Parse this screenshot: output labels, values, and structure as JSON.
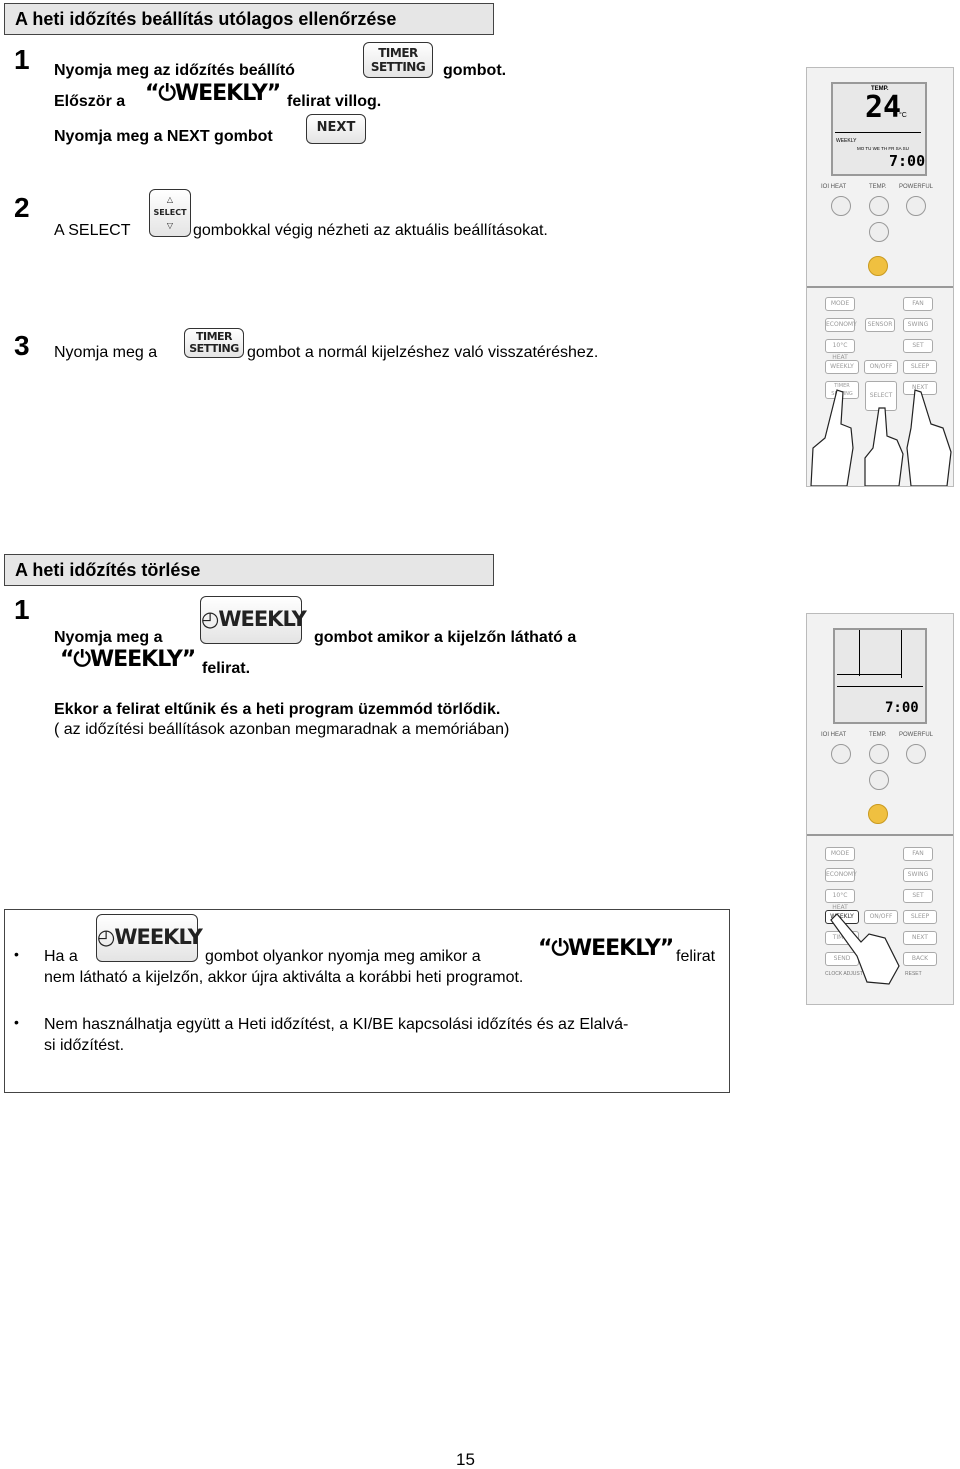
{
  "section1": {
    "title": "A heti időzítés beállítás utólagos ellenőrzése",
    "step1": {
      "number": "1",
      "line1a": "Nyomja meg az időzítés beállító",
      "line1b": "gombot.",
      "line2a": "Először a",
      "line2b": "felirat villog.",
      "line3": "Nyomja meg a NEXT gombot"
    },
    "step2": {
      "number": "2",
      "before": "A SELECT",
      "after": "gombokkal végig nézheti az aktuális beállításokat."
    },
    "step3": {
      "number": "3",
      "before": "Nyomja meg a",
      "after": "gombot a normál kijelzéshez való visszatéréshez."
    }
  },
  "section2": {
    "title": "A heti időzítés törlése",
    "step1": {
      "number": "1",
      "line1a": "Nyomja meg a",
      "line1b": "gombot amikor a kijelzőn látható a",
      "line2": "felirat.",
      "line3": "Ekkor a felirat eltűnik és a heti program üzemmód törlődik.",
      "line4": "( az időzítési beállítások azonban megmaradnak a memóriában)"
    }
  },
  "notes": [
    {
      "before": "Ha a",
      "middle": "gombot olyankor nyomja meg amikor a",
      "after": "felirat",
      "line2": "nem látható a kijelzőn, akkor újra aktiválta a korábbi heti programot."
    },
    {
      "line1": "Nem használhatja együtt  a  Heti időzítést,  a KI/BE kapcsolási időzítés és az Elalvá-",
      "line2": "si időzítést."
    }
  ],
  "buttons": {
    "timer_line1": "TIMER",
    "timer_line2": "SETTING",
    "next": "NEXT",
    "select": "SELECT",
    "weekly": "WEEKLY",
    "weekly_quoted": "“⏻WEEKLY”"
  },
  "remote1": {
    "temp_label": "TEMP.",
    "temp": "24",
    "unit": "°C",
    "weekly": "WEEKLY",
    "days": "MO TU WE TH FR SA SU",
    "time": "7:00",
    "labels": [
      "IOI HEAT",
      "TEMP.",
      "POWERFUL"
    ],
    "keys": [
      "MODE",
      "FAN",
      "ECONOMY",
      "SENSOR",
      "SWING",
      "10°C HEAT",
      "SET",
      "WEEKLY",
      "ON/OFF",
      "SLEEP",
      "TIMER SETTING",
      "SELECT",
      "NEXT"
    ]
  },
  "remote2": {
    "time": "7:00",
    "labels": [
      "IOI HEAT",
      "TEMP.",
      "POWERFUL"
    ],
    "keys": [
      "MODE",
      "FAN",
      "ECONOMY",
      "SWING",
      "10°C HEAT",
      "SET",
      "WEEKLY",
      "ON/OFF",
      "SLEEP",
      "TIMER",
      "NEXT",
      "SEND",
      "BACK",
      "CLOCK ADJUST",
      "RESET"
    ]
  },
  "page_number": "15",
  "colors": {
    "header_bg": "#e6e6e6",
    "power_button": "#f0c040"
  }
}
